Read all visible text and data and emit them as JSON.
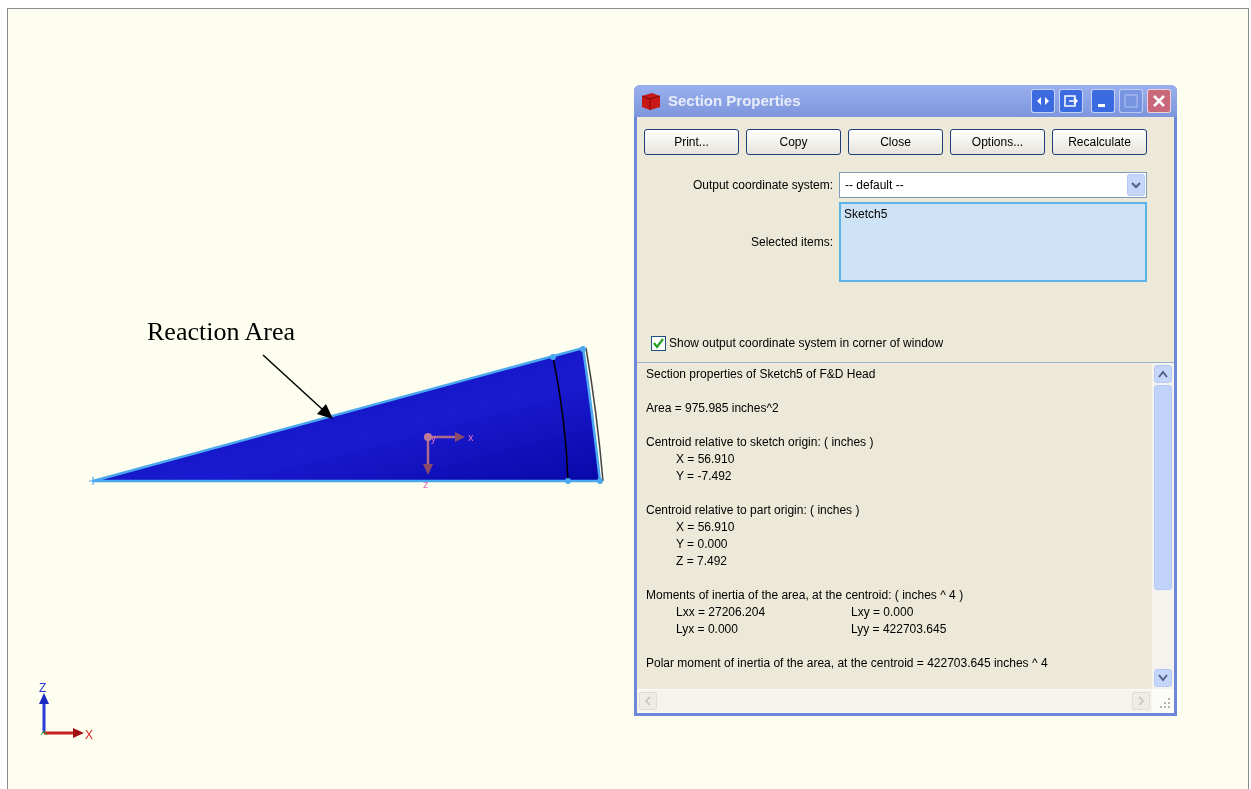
{
  "canvas": {
    "callout": "Reaction Area",
    "centroid_axes": {
      "origin_label": "y",
      "x_label": "x",
      "z_label": "z"
    },
    "corner_triad": {
      "up_label": "Z",
      "right_label": "X"
    }
  },
  "dialog": {
    "title": "Section Properties",
    "buttons": [
      "Print...",
      "Copy",
      "Close",
      "Options...",
      "Recalculate"
    ],
    "coordinate_system": {
      "label": "Output coordinate system:",
      "value": "-- default --"
    },
    "selected_items": {
      "label": "Selected items:",
      "items": [
        "Sketch5"
      ]
    },
    "show_coordinate_system": {
      "label": "Show output coordinate system in corner of window",
      "checked": true
    },
    "results": [
      {
        "text": "Section properties of Sketch5 of F&D Head"
      },
      {
        "text": "Area = 975.985 inches^2"
      },
      {
        "text": "Centroid relative to sketch origin: ( inches )",
        "rows": [
          [
            "X = 56.910"
          ],
          [
            "Y = -7.492"
          ]
        ]
      },
      {
        "text": "Centroid relative to part origin: ( inches )",
        "rows": [
          [
            "X = 56.910"
          ],
          [
            "Y = 0.000"
          ],
          [
            "Z = 7.492"
          ]
        ]
      },
      {
        "text": "Moments of inertia of the area, at the centroid: ( inches ^ 4 )",
        "rows": [
          [
            "Lxx = 27206.204",
            "Lxy = 0.000"
          ],
          [
            "Lyx = 0.000",
            "Lyy = 422703.645"
          ]
        ]
      },
      {
        "text": "Polar moment of inertia of the area, at the centroid = 422703.645 inches ^ 4"
      }
    ]
  }
}
